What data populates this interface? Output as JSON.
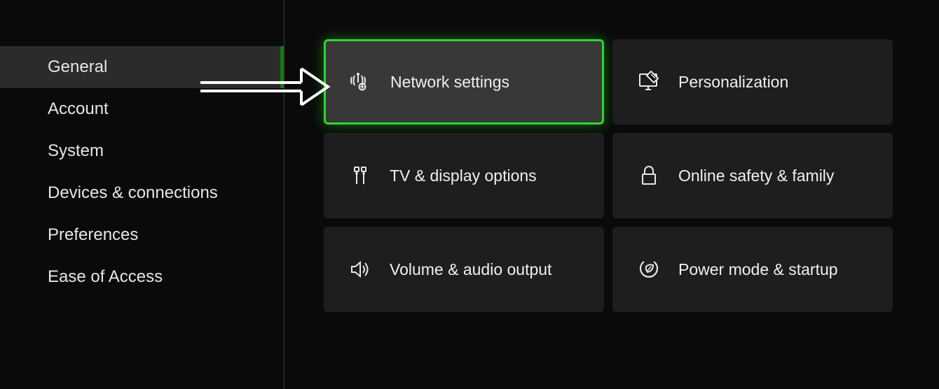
{
  "sidebar": {
    "items": [
      {
        "label": "General",
        "active": true
      },
      {
        "label": "Account",
        "active": false
      },
      {
        "label": "System",
        "active": false
      },
      {
        "label": "Devices & connections",
        "active": false
      },
      {
        "label": "Preferences",
        "active": false
      },
      {
        "label": "Ease of Access",
        "active": false
      }
    ]
  },
  "tiles": {
    "network": "Network settings",
    "personalization": "Personalization",
    "display": "TV & display options",
    "safety": "Online safety & family",
    "audio": "Volume & audio output",
    "power": "Power mode & startup"
  },
  "colors": {
    "accent": "#2fd52f",
    "tileBg": "#1e1e1e",
    "tileActiveBg": "#383838",
    "bg": "#0a0a0a"
  }
}
